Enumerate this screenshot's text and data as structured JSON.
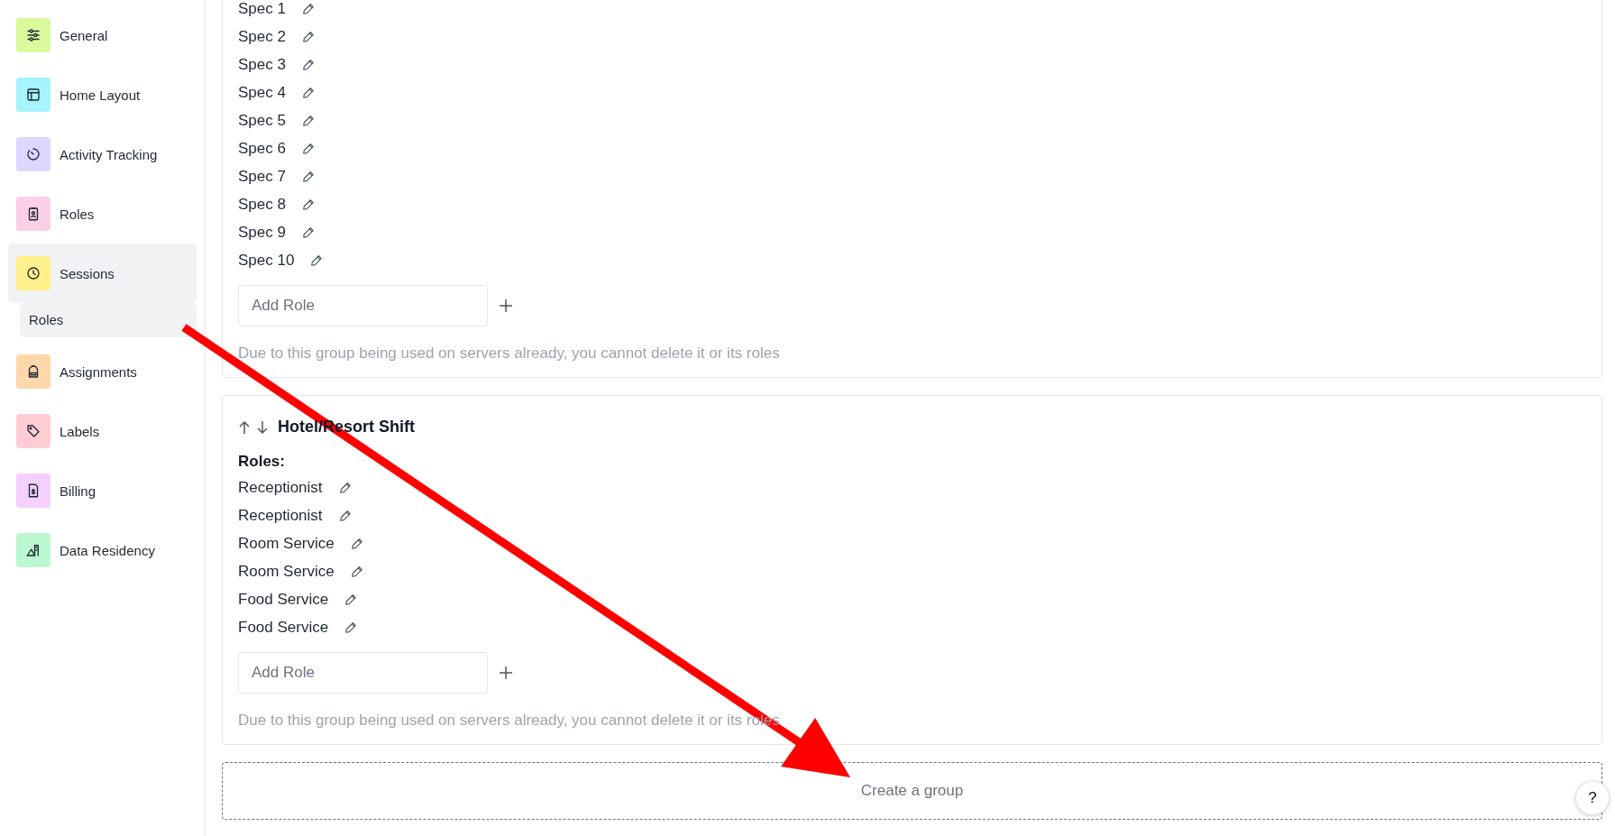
{
  "sidebar": {
    "items": [
      {
        "label": "General",
        "color": "#d9f99d",
        "selected": false
      },
      {
        "label": "Home Layout",
        "color": "#a5f3fc",
        "selected": false
      },
      {
        "label": "Activity Tracking",
        "color": "#ddd6fe",
        "selected": false
      },
      {
        "label": "Roles",
        "color": "#fbcfe8",
        "selected": false
      },
      {
        "label": "Sessions",
        "color": "#fef08a",
        "selected": true,
        "children": [
          {
            "label": "Roles",
            "selected": true
          }
        ]
      },
      {
        "label": "Assignments",
        "color": "#fed7aa",
        "selected": false
      },
      {
        "label": "Labels",
        "color": "#fecdd3",
        "selected": false
      },
      {
        "label": "Billing",
        "color": "#f5d0fe",
        "selected": false
      },
      {
        "label": "Data Residency",
        "color": "#bbf7d0",
        "selected": false
      }
    ]
  },
  "groups": [
    {
      "roles": [
        "Spec 1",
        "Spec 2",
        "Spec 3",
        "Spec 4",
        "Spec 5",
        "Spec 6",
        "Spec 7",
        "Spec 8",
        "Spec 9",
        "Spec 10"
      ],
      "add_role": {
        "placeholder": "Add Role"
      },
      "note": "Due to this group being used on servers already, you cannot delete it or its roles"
    },
    {
      "title": "Hotel/Resort Shift",
      "roles_label": "Roles:",
      "roles": [
        "Receptionist",
        "Receptionist",
        "Room Service",
        "Room Service",
        "Food Service",
        "Food Service"
      ],
      "add_role": {
        "placeholder": "Add Role"
      },
      "note": "Due to this group being used on servers already, you cannot delete it or its roles"
    }
  ],
  "create_group": "Create a group",
  "help_button": "?"
}
